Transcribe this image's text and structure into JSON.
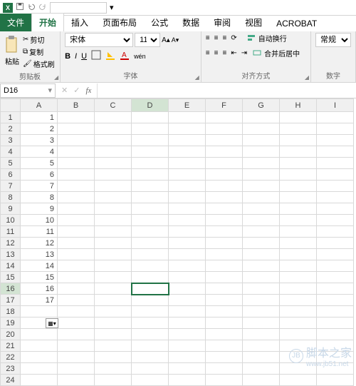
{
  "qat": {
    "input_value": ""
  },
  "tabs": {
    "file": "文件",
    "items": [
      "开始",
      "插入",
      "页面布局",
      "公式",
      "数据",
      "审阅",
      "视图",
      "ACROBAT"
    ],
    "active_index": 0
  },
  "ribbon": {
    "clipboard": {
      "paste": "粘贴",
      "cut": "剪切",
      "copy": "复制",
      "format_painter": "格式刷",
      "label": "剪贴板"
    },
    "font": {
      "name": "宋体",
      "size": "11",
      "label": "字体",
      "bold": "B",
      "italic": "I",
      "underline": "U"
    },
    "align": {
      "wrap": "自动换行",
      "merge": "合并后居中",
      "label": "对齐方式"
    },
    "number": {
      "format": "常规",
      "label": "数字"
    }
  },
  "namebox": {
    "ref": "D16"
  },
  "formula_bar": {
    "value": ""
  },
  "grid": {
    "columns": [
      "A",
      "B",
      "C",
      "D",
      "E",
      "F",
      "G",
      "H",
      "I"
    ],
    "rows": [
      1,
      2,
      3,
      4,
      5,
      6,
      7,
      8,
      9,
      10,
      11,
      12,
      13,
      14,
      15,
      16,
      17,
      18,
      19,
      20,
      21,
      22,
      23,
      24
    ],
    "colA": {
      "1": "1",
      "2": "2",
      "3": "3",
      "4": "4",
      "5": "5",
      "6": "6",
      "7": "7",
      "8": "8",
      "9": "9",
      "10": "10",
      "11": "11",
      "12": "12",
      "13": "13",
      "14": "14",
      "15": "15",
      "16": "16",
      "17": "17"
    },
    "selected": {
      "row": 16,
      "col": "D"
    }
  },
  "watermark": {
    "site": "脚本之家",
    "url": "www.jb51.net"
  }
}
